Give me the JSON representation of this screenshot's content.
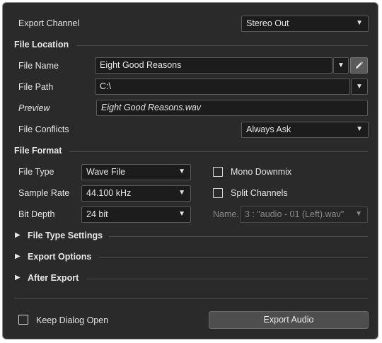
{
  "export_channel": {
    "label": "Export Channel",
    "value": "Stereo Out"
  },
  "file_location": {
    "title": "File Location",
    "file_name_label": "File Name",
    "file_name_value": "Eight Good Reasons",
    "file_path_label": "File Path",
    "file_path_value": "C:\\",
    "preview_label": "Preview",
    "preview_value": "Eight Good Reasons.wav",
    "file_conflicts_label": "File Conflicts",
    "file_conflicts_value": "Always Ask"
  },
  "file_format": {
    "title": "File Format",
    "file_type_label": "File Type",
    "file_type_value": "Wave File",
    "sample_rate_label": "Sample Rate",
    "sample_rate_value": "44.100 kHz",
    "bit_depth_label": "Bit Depth",
    "bit_depth_value": "24 bit",
    "mono_downmix_label": "Mono Downmix",
    "split_channels_label": "Split Channels",
    "name_label": "Name.",
    "name_value": "3 : \"audio - 01 (Left).wav\""
  },
  "collapsed_sections": {
    "file_type_settings": "File Type Settings",
    "export_options": "Export Options",
    "after_export": "After Export"
  },
  "footer": {
    "keep_dialog_open_label": "Keep Dialog Open",
    "export_button_label": "Export Audio"
  },
  "icons": {
    "dropdown": "chevron-down-icon",
    "edit": "pencil-icon",
    "expand": "triangle-right-icon"
  },
  "colors": {
    "background": "#2a2a2a",
    "field": "#1c1c1c",
    "text": "#e6e6e6",
    "disabled_text": "#8a8a8a",
    "button": "#4e4e4e"
  }
}
